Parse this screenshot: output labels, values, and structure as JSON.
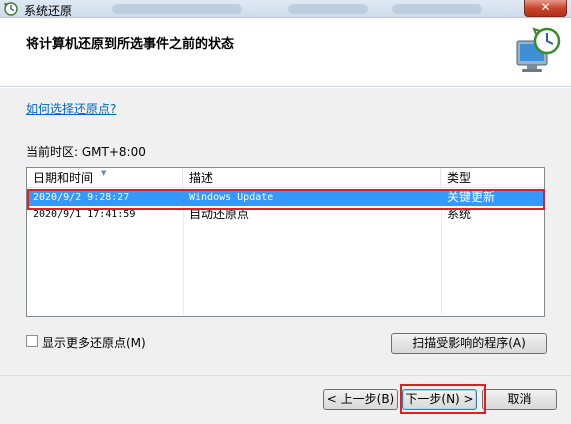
{
  "window": {
    "title": "系统还原",
    "close_label": "✕"
  },
  "header": {
    "title": "将计算机还原到所选事件之前的状态",
    "icon": "monitor-clock-icon"
  },
  "content": {
    "help_link": "如何选择还原点?",
    "timezone": "当前时区: GMT+8:00"
  },
  "restore_points": {
    "columns": [
      "日期和时间",
      "描述",
      "类型"
    ],
    "rows": [
      {
        "date": "2020/9/2 9:28:27",
        "description": "Windows Update",
        "type": "关键更新",
        "selected": true
      },
      {
        "date": "2020/9/1 17:41:59",
        "description": "自动还原点",
        "type": "系统",
        "selected": false
      }
    ]
  },
  "options": {
    "show_more_label": "显示更多还原点(M)",
    "show_more_checked": false,
    "scan_button": "扫描受影响的程序(A)"
  },
  "footer": {
    "back_button": "< 上一步(B)",
    "next_button": "下一步(N) >",
    "cancel_button": "取消"
  },
  "colors": {
    "selection": "#3399ff",
    "highlight_box": "#e02020",
    "link": "#0066cc"
  }
}
